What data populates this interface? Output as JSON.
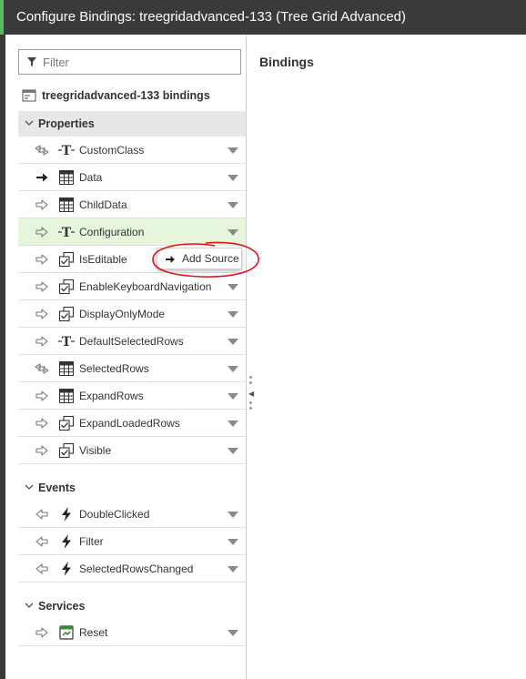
{
  "window": {
    "title": "Configure Bindings: treegridadvanced-133 (Tree Grid Advanced)"
  },
  "filter": {
    "placeholder": "Filter",
    "value": ""
  },
  "tree": {
    "header": "treegridadvanced-133 bindings"
  },
  "right_panel": {
    "title": "Bindings"
  },
  "sections": {
    "properties": {
      "label": "Properties",
      "items": [
        {
          "label": "CustomClass",
          "direction": "bidirectional",
          "type": "text"
        },
        {
          "label": "Data",
          "direction": "bound-in",
          "type": "table"
        },
        {
          "label": "ChildData",
          "direction": "in",
          "type": "table"
        },
        {
          "label": "Configuration",
          "direction": "in",
          "type": "text"
        },
        {
          "label": "IsEditable",
          "direction": "in",
          "type": "boolean"
        },
        {
          "label": "EnableKeyboardNavigation",
          "direction": "in",
          "type": "boolean"
        },
        {
          "label": "DisplayOnlyMode",
          "direction": "in",
          "type": "boolean"
        },
        {
          "label": "DefaultSelectedRows",
          "direction": "in",
          "type": "text"
        },
        {
          "label": "SelectedRows",
          "direction": "bidirectional",
          "type": "table"
        },
        {
          "label": "ExpandRows",
          "direction": "in",
          "type": "table"
        },
        {
          "label": "ExpandLoadedRows",
          "direction": "in",
          "type": "boolean"
        },
        {
          "label": "Visible",
          "direction": "in",
          "type": "boolean"
        }
      ]
    },
    "events": {
      "label": "Events",
      "items": [
        {
          "label": "DoubleClicked",
          "direction": "out",
          "type": "event"
        },
        {
          "label": "Filter",
          "direction": "out",
          "type": "event"
        },
        {
          "label": "SelectedRowsChanged",
          "direction": "out",
          "type": "event"
        }
      ]
    },
    "services": {
      "label": "Services",
      "items": [
        {
          "label": "Reset",
          "direction": "in",
          "type": "service"
        }
      ]
    }
  },
  "popup": {
    "label": "Add Source"
  },
  "colors": {
    "titlebar": "#3a3a3a",
    "accent": "#5cb85c",
    "highlight_row": "#e6f6dc",
    "annotation": "#e0141a"
  }
}
